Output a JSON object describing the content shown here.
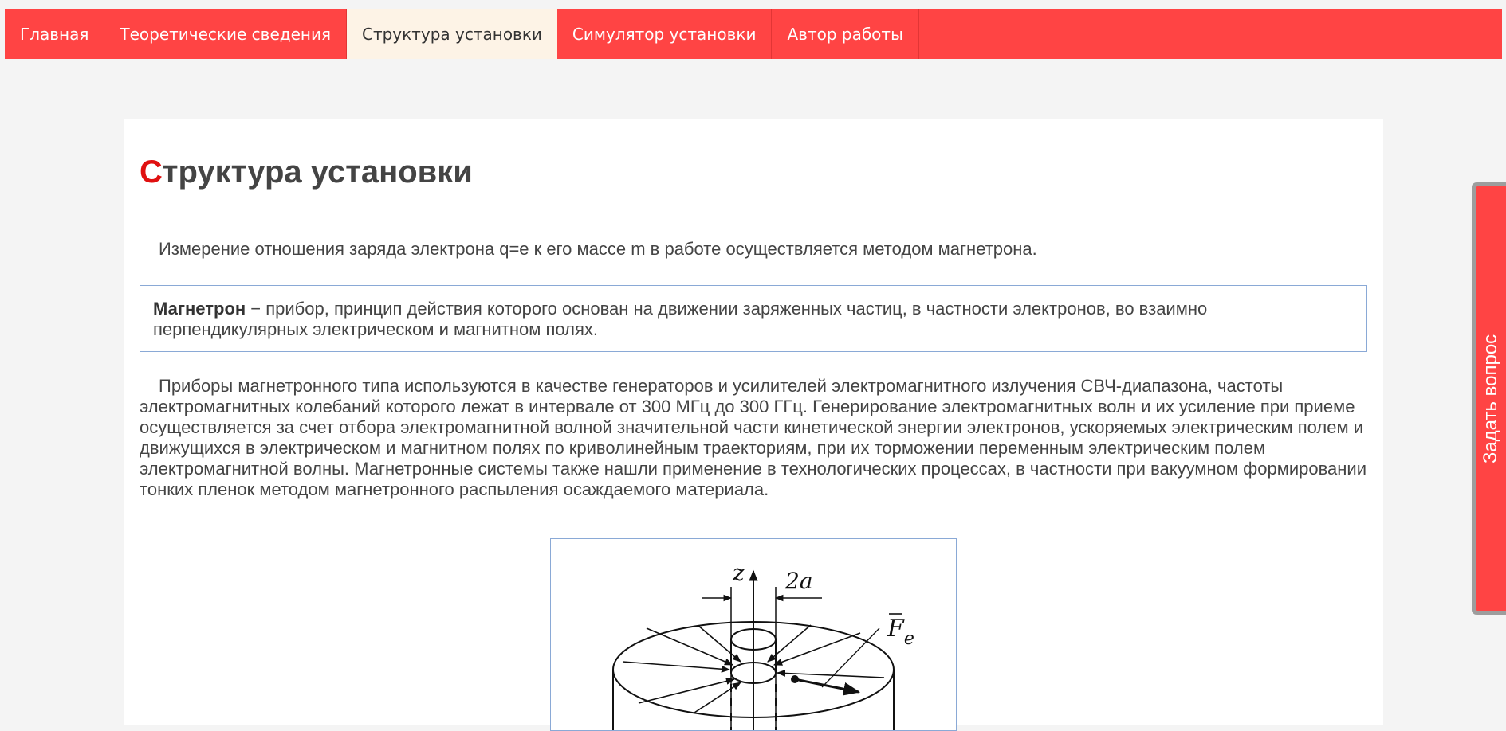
{
  "nav": {
    "tabs": [
      {
        "label": "Главная",
        "active": false
      },
      {
        "label": "Теоретические сведения",
        "active": false
      },
      {
        "label": "Структура установки",
        "active": true
      },
      {
        "label": "Симулятор установки",
        "active": false
      },
      {
        "label": "Автор работы",
        "active": false
      }
    ]
  },
  "page": {
    "title_first_letter": "С",
    "title_rest": "труктура установки",
    "intro": "Измерение отношения заряда электрона q=e к его массе m в работе осуществляется методом магнетрона.",
    "definition_term": "Магнетрон",
    "definition_text": " − прибор, принцип действия которого основан на движении заряженных частиц, в частности электронов, во взаимно перпендикулярных электрическом и магнитном полях.",
    "description": "Приборы магнетронного типа используются в качестве генераторов и усилителей электромагнитного излучения СВЧ-диапазона, частоты электромагнитных колебаний которого лежат в интервале от 300 МГц до 300 ГГц. Генерирование электромагнитных волн и их усиление при приеме осуществляется за счет отбора электромагнитной волной значительной части кинетической энергии электронов, ускоряемых электрическим полем и движущихся в электрическом и магнитном полях по криволинейным траекториям, при их торможении переменным электрическим полем электромагнитной волны. Магнетронные системы также нашли применение в технологических процессах, в частности при вакуумном формировании тонких пленок методом магнетронного распыления осаждаемого материала."
  },
  "figure": {
    "label_z": "z",
    "label_2a": "2a",
    "label_F": "F",
    "label_F_sub": "e"
  },
  "ask": {
    "label": "Задать вопрос"
  },
  "colors": {
    "accent": "#ff4444",
    "active_tab_bg": "#fdf3e6",
    "title_first_letter": "#e01010",
    "box_border": "#8aa9d6"
  }
}
